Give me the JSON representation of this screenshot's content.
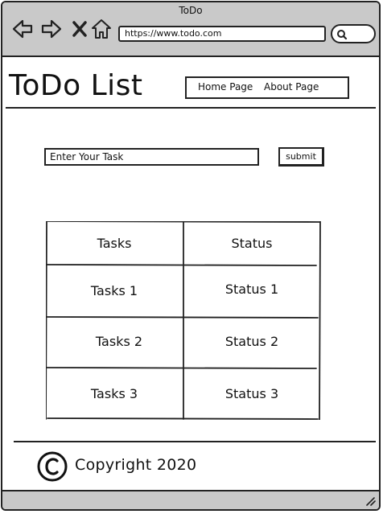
{
  "browser": {
    "window_title": "ToDo",
    "url": "https://www.todo.com",
    "icons": [
      "back-icon",
      "forward-icon",
      "close-icon",
      "home-icon",
      "search-icon"
    ]
  },
  "header": {
    "site_title": "ToDo List",
    "nav": [
      {
        "label": "Home Page"
      },
      {
        "label": "About Page"
      }
    ]
  },
  "form": {
    "input_value": "Enter Your Task",
    "submit_label": "submit"
  },
  "table": {
    "headers": [
      "Tasks",
      "Status"
    ],
    "rows": [
      [
        "Tasks 1",
        "Status 1"
      ],
      [
        "Tasks 2",
        "Status 2"
      ],
      [
        "Tasks 3",
        "Status 3"
      ]
    ]
  },
  "footer": {
    "copyright_text": "Copyright 2020",
    "icon": "copyright-icon"
  },
  "colors": {
    "chrome_gray": "#c9c9c9",
    "ink": "#222222",
    "page_bg": "#ffffff"
  }
}
